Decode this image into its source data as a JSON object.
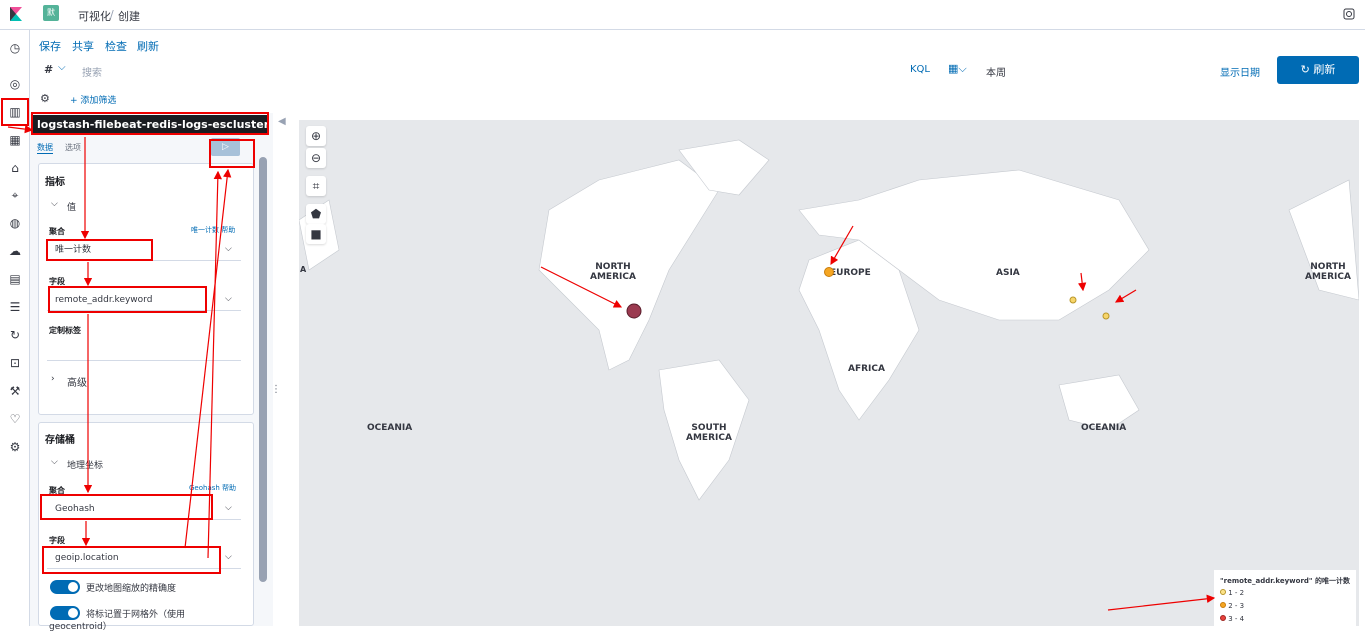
{
  "app": {
    "space_badge": "默",
    "breadcrumb": [
      "可视化",
      "创建"
    ]
  },
  "menu": {
    "items": [
      "保存",
      "共享",
      "检查",
      "刷新"
    ]
  },
  "query": {
    "type_label": "#",
    "search_placeholder": "搜索",
    "kql": "KQL",
    "date_value": "本周",
    "show_dates": "显示日期",
    "refresh_label": "刷新"
  },
  "filter": {
    "add": "+ 添加筛选"
  },
  "editor": {
    "index_title": "logstash-filebeat-redis-logs-escluster-...",
    "tabs": [
      "数据",
      "选项"
    ],
    "metrics": {
      "title": "指标",
      "item": "值",
      "agg_label": "聚合",
      "agg_help": "唯一计数 帮助",
      "agg_value": "唯一计数",
      "field_label": "字段",
      "field_value": "remote_addr.keyword",
      "custom_label": "定制标签",
      "advanced": "高级"
    },
    "buckets": {
      "title": "存储桶",
      "item": "地理坐标",
      "agg_label": "聚合",
      "agg_help": "Geohash 帮助",
      "agg_value": "Geohash",
      "field_label": "字段",
      "field_value": "geoip.location",
      "toggle1": "更改地图缩放的精确度",
      "toggle2": "将标记置于网格外（使用",
      "toggle2b": "geocentroid）"
    }
  },
  "map": {
    "labels": {
      "na_left": "NORTH\nAMERICA",
      "europe": "EUROPE",
      "asia": "ASIA",
      "na_right": "NORTH\nAMERICA",
      "africa": "AFRICA",
      "oceania_left": "OCEANIA",
      "south_america": "SOUTH\nAMERICA",
      "oceania_right": "OCEANIA",
      "edge_a": "A"
    },
    "legend": {
      "title": "\"remote_addr.keyword\" 的唯一计数",
      "items": [
        {
          "label": "1 - 2",
          "color": "#fce38a"
        },
        {
          "label": "2 - 3",
          "color": "#f5a623"
        },
        {
          "label": "3 - 4",
          "color": "#e8423c"
        }
      ]
    },
    "points": [
      {
        "name": "north-america-point",
        "color": "#9b3a50"
      },
      {
        "name": "europe-point",
        "color": "#f5a623"
      },
      {
        "name": "asia-point-1",
        "color": "#f7d56a"
      },
      {
        "name": "asia-point-2",
        "color": "#f7d56a"
      }
    ]
  },
  "colors": {
    "accent": "#006bb4",
    "dark": "#1a1c21",
    "annotation": "#e00000"
  }
}
